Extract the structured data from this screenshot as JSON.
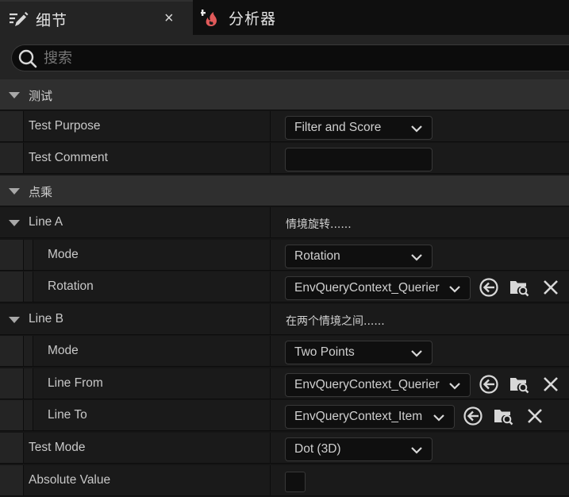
{
  "tabs": [
    {
      "label": "细节",
      "icon": "details-pencil-icon",
      "active": true,
      "close": "×"
    },
    {
      "label": "分析器",
      "icon": "profiler-flame-icon",
      "active": false
    }
  ],
  "search": {
    "placeholder": "搜索"
  },
  "categories": {
    "test": "测试",
    "dot": "点乘"
  },
  "rows": {
    "test_purpose": {
      "label": "Test Purpose",
      "value": "Filter and Score"
    },
    "test_comment": {
      "label": "Test Comment",
      "value": ""
    },
    "line_a": {
      "label": "Line A",
      "summary": "情境旋转......"
    },
    "line_a_mode": {
      "label": "Mode",
      "value": "Rotation"
    },
    "line_a_rotation": {
      "label": "Rotation",
      "value": "EnvQueryContext_Querier"
    },
    "line_b": {
      "label": "Line B",
      "summary": "在两个情境之间......"
    },
    "line_b_mode": {
      "label": "Mode",
      "value": "Two Points"
    },
    "line_from": {
      "label": "Line From",
      "value": "EnvQueryContext_Querier"
    },
    "line_to": {
      "label": "Line To",
      "value": "EnvQueryContext_Item"
    },
    "test_mode": {
      "label": "Test Mode",
      "value": "Dot (3D)"
    },
    "absolute_value": {
      "label": "Absolute Value",
      "checked": false
    }
  },
  "colors": {
    "panel_bg": "#1a1a1a",
    "category_bg": "#2f2f2f",
    "field_bg": "#0f0f0f",
    "text": "#c8c8c8",
    "flame_accent": "#e05a5a"
  }
}
